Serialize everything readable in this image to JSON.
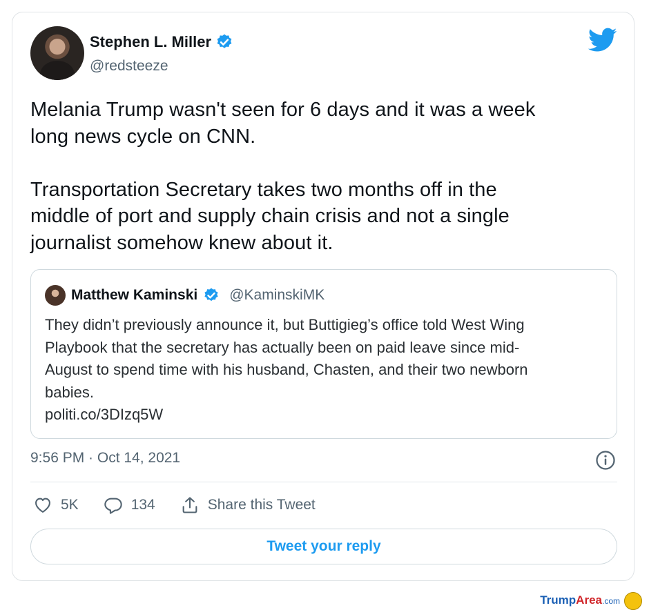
{
  "tweet": {
    "author_name": "Stephen L. Miller",
    "author_handle": "@redsteeze",
    "text": "Melania Trump wasn't seen for 6 days and it was a week\nlong news cycle on CNN.\n\nTransportation Secretary takes two months off in the\nmiddle of port and supply chain crisis and not a single\njournalist somehow knew about it.",
    "timestamp": "9:56 PM · Oct 14, 2021"
  },
  "quote": {
    "author_name": "Matthew Kaminski",
    "author_handle": "@KaminskiMK",
    "text": "They didn’t previously announce it, but Buttigieg’s office told West Wing\nPlaybook that the secretary has actually been on paid leave since mid-\nAugust to spend time with his husband, Chasten, and their two newborn\nbabies.\n politi.co/3DIzq5W"
  },
  "actions": {
    "likes": "5K",
    "replies": "134",
    "share_label": "Share this Tweet"
  },
  "reply_button": "Tweet your reply",
  "watermark": {
    "brand_a": "Trump",
    "brand_b": "Area",
    "brand_c": ".com"
  },
  "colors": {
    "accent": "#1d9bf0",
    "secondary_text": "#536471",
    "border": "#cfd9de"
  },
  "icons": [
    "verified-icon",
    "twitter-bird-icon",
    "info-icon",
    "heart-icon",
    "reply-icon",
    "share-icon"
  ]
}
